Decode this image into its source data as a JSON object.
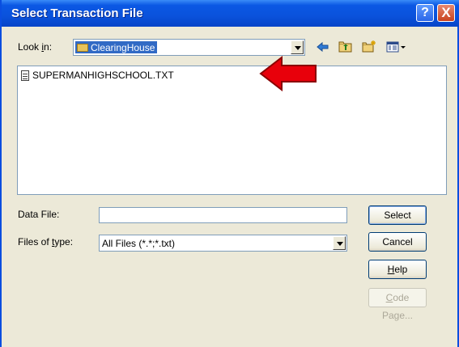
{
  "dialog": {
    "title": "Select Transaction File",
    "title_buttons": {
      "help": "?",
      "close": "X"
    }
  },
  "look_in": {
    "label_prefix": "Look ",
    "label_underlined": "i",
    "label_suffix": "n:",
    "folder": "ClearingHouse"
  },
  "toolbar": {
    "icons": [
      "back-icon",
      "up-folder-icon",
      "new-folder-icon",
      "view-menu-icon"
    ]
  },
  "files": [
    {
      "name": "SUPERMANHIGHSCHOOL.TXT",
      "icon": "text-file-icon"
    }
  ],
  "data_file": {
    "label": "Data File:",
    "value": ""
  },
  "files_of_type": {
    "label_prefix": "Files of ",
    "label_underlined": "t",
    "label_suffix": "ype:",
    "value": "All Files (*.*;*.txt)"
  },
  "buttons": {
    "select": "Select",
    "cancel": "Cancel",
    "help_underlined": "H",
    "help_rest": "elp",
    "code_page_underlined": "C",
    "code_page_rest": "ode Page..."
  },
  "colors": {
    "title_bar": "#0a52dc",
    "dialog_bg": "#ece9d8",
    "selection": "#316ac5",
    "annotation_arrow": "#e8000b"
  }
}
